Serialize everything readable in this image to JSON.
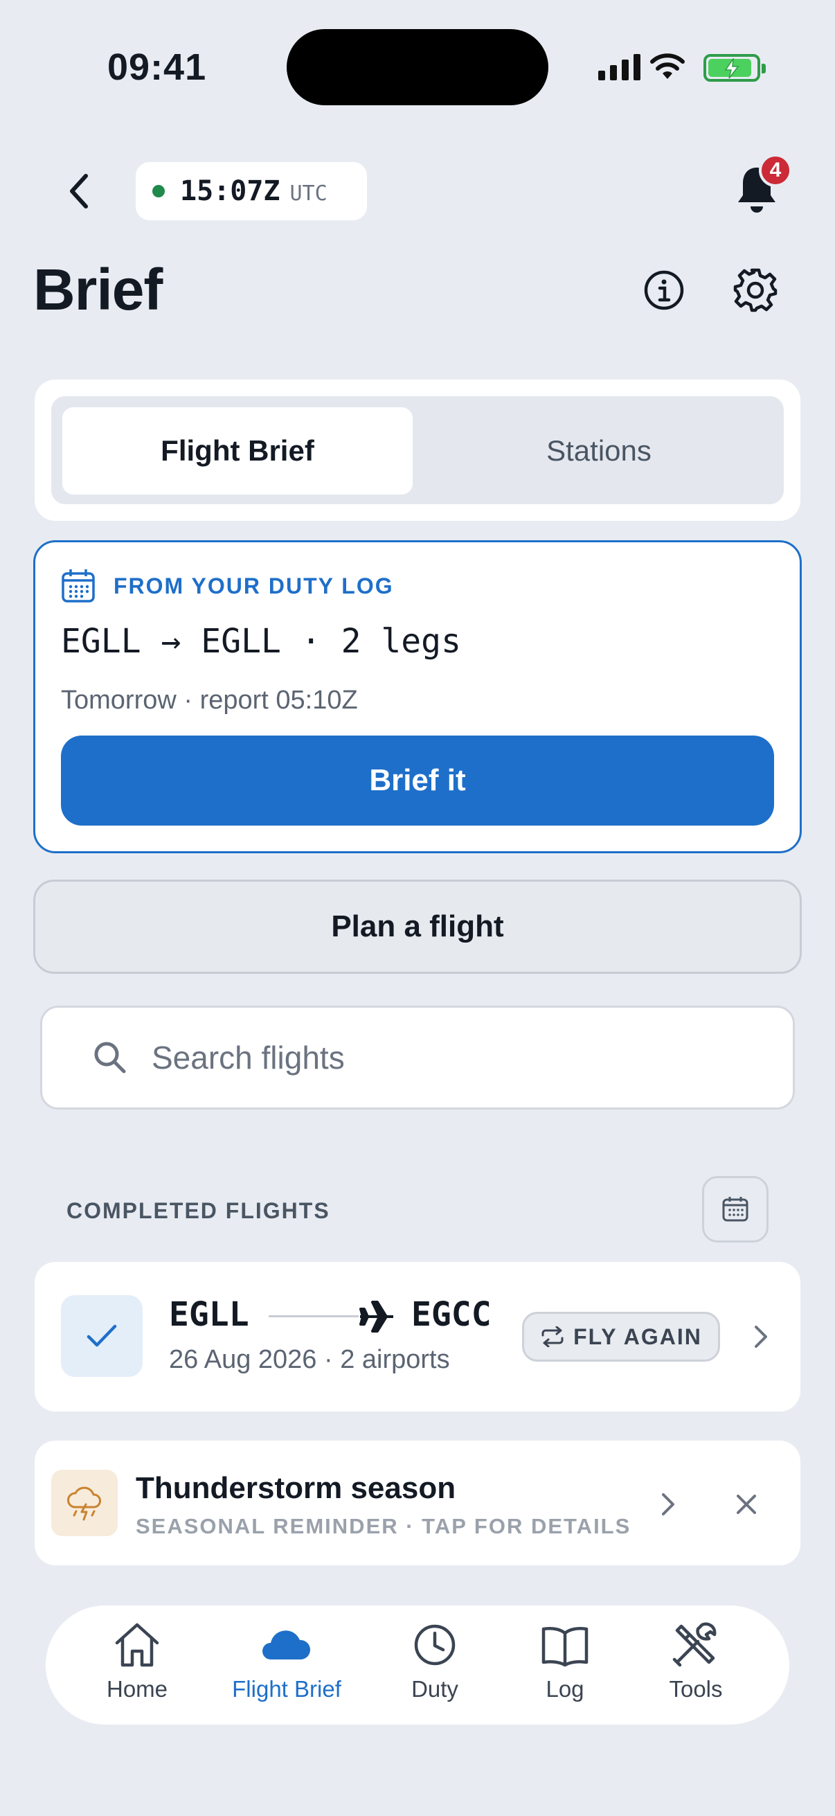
{
  "status_bar": {
    "time": "09:41"
  },
  "header": {
    "utc_time": "15:07Z",
    "utc_unit": "UTC",
    "notification_count": "4",
    "title": "Brief"
  },
  "segments": {
    "active": "Flight Brief",
    "other": "Stations"
  },
  "duty": {
    "label": "FROM YOUR DUTY LOG",
    "route": "EGLL → EGLL · 2 legs",
    "subtitle": "Tomorrow · report 05:10Z",
    "button": "Brief it"
  },
  "plan_button": "Plan a flight",
  "search": {
    "placeholder": "Search flights"
  },
  "completed": {
    "section_label": "COMPLETED FLIGHTS",
    "flights": [
      {
        "from": "EGLL",
        "to": "EGCC",
        "subtitle": "26 Aug 2026 · 2 airports",
        "action": "FLY AGAIN"
      }
    ]
  },
  "reminder": {
    "title": "Thunderstorm season",
    "subtitle": "SEASONAL REMINDER · TAP FOR DETAILS"
  },
  "tabbar": {
    "items": [
      {
        "label": "Home",
        "icon": "home-icon"
      },
      {
        "label": "Flight Brief",
        "icon": "cloud-icon",
        "active": true
      },
      {
        "label": "Duty",
        "icon": "clock-icon"
      },
      {
        "label": "Log",
        "icon": "book-icon"
      },
      {
        "label": "Tools",
        "icon": "tools-icon"
      }
    ]
  },
  "colors": {
    "accent": "#1e6fc9",
    "background": "#e8ecf2",
    "badge": "#cc2a36",
    "status_green": "#1f8a4c",
    "storm_orange": "#c9832f"
  }
}
